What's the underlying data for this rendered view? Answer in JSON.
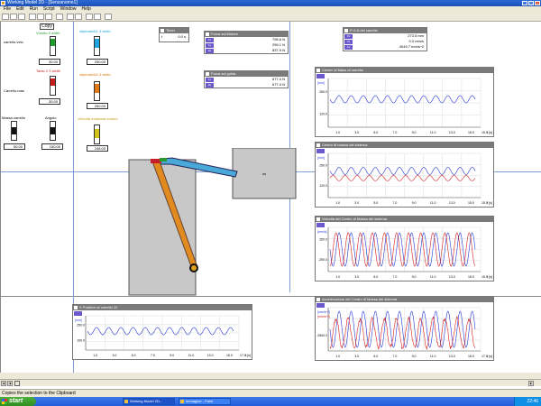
{
  "app": {
    "title": "Working Model 2D - [Senzanome1]",
    "window_buttons": [
      "_",
      "□",
      "×"
    ]
  },
  "menu": [
    "File",
    "Edit",
    "Run",
    "Script",
    "Window",
    "Help"
  ],
  "run_controls": {
    "run": "Run",
    "stop": "Stop",
    "reset": "Reset"
  },
  "copy_button": "Copy",
  "controls": [
    {
      "label": "carrello-velo",
      "value": "30.00",
      "color": "#1f9e2d"
    },
    {
      "label": "Carrello-mas",
      "value": "30.00",
      "color": "#c81e1e"
    },
    {
      "label": "Massa carrello",
      "value": "50.00",
      "color": "#111111"
    },
    {
      "label": "Angolo",
      "value": "150.00",
      "color": "#111111"
    },
    {
      "label": "stiperaddb1 3 width",
      "value": "250.00",
      "color": "#1ea5e0"
    },
    {
      "label": "stiperaddb2 3 width",
      "value": "250.00",
      "color": "#e07a14"
    },
    {
      "label": "Velocità massima motore",
      "value": "248.00",
      "color": "#d0c21a"
    }
  ],
  "control_labels_small": [
    "Vmotto 0 width",
    "Tanto 2 3 width"
  ],
  "meters": {
    "timer": {
      "title": "Timer",
      "label": "t",
      "value": "0.0 s"
    },
    "forza_motore": {
      "title": "Forza sul Motore",
      "rows": [
        {
          "key": "Fx",
          "value": "795.6 N"
        },
        {
          "key": "Fy",
          "value": "259.1 N"
        },
        {
          "key": "|F|",
          "value": "837.9 N"
        }
      ]
    },
    "forza_guida": {
      "title": "Forza sul guida",
      "rows": [
        {
          "key": "Fy",
          "value": "677.4 N"
        },
        {
          "key": "|F|",
          "value": "677.4 N"
        }
      ]
    },
    "pva": {
      "title": "P-V-A del carrello",
      "rows": [
        {
          "key": "Px",
          "value": "273.5 mm"
        },
        {
          "key": "Vx",
          "value": "0.0 mm/s"
        },
        {
          "key": "Ax",
          "value": "4049.7 mm/s^2"
        }
      ]
    }
  },
  "graphs": [
    {
      "title": "Center of Mass of carrello",
      "y_unit": "[mm]",
      "y_ticks": [
        "250.0",
        "120.0"
      ],
      "x_ticks": [
        "1.0",
        "3.0",
        "5.0",
        "7.0",
        "9.0",
        "11.0",
        "13.0",
        "15.0"
      ],
      "x_axis_end": "15.0",
      "x_label": "t [s]"
    },
    {
      "title": "Centro di massa del sistema",
      "y_unit": "[mm]",
      "y_ticks": [
        "250.0",
        "120.0"
      ],
      "x_ticks": [
        "1.0",
        "3.0",
        "5.0",
        "7.0",
        "9.0",
        "11.0",
        "13.0",
        "15.0"
      ],
      "x_axis_end": "15.0",
      "x_label": "t [s]"
    },
    {
      "title": "Velocità del Centro di Massa del sistema",
      "y_unit": "[mm/s]",
      "y_ticks": [
        "250.0",
        "-250.0"
      ],
      "x_ticks": [
        "1.0",
        "3.0",
        "5.0",
        "7.0",
        "9.0",
        "11.0",
        "13.0",
        "15.0"
      ],
      "x_axis_end": "15.0",
      "x_label": "t [s]"
    },
    {
      "title": "X Position of carrello 10",
      "y_unit": "[mm]",
      "y_ticks": [
        "250.0",
        "100.0"
      ],
      "x_ticks": [
        "1.0",
        "3.0",
        "5.0",
        "7.0",
        "9.0",
        "11.0",
        "13.0",
        "15.0"
      ],
      "x_axis_end": "17.0",
      "x_label": "t [s]"
    },
    {
      "title": "Accelerazione del Centro di Massa del sistema",
      "y_unit": "[mm/s^2]",
      "y_unit2": "[mm/s^2]",
      "y_ticks": [
        "-2500.0"
      ],
      "x_ticks": [
        "1.0",
        "3.0",
        "5.0",
        "7.0",
        "9.0",
        "11.0",
        "13.0",
        "15.0"
      ],
      "x_axis_end": "17.0",
      "x_label": "t [s]"
    }
  ],
  "status": "Copies the selection to the Clipboard",
  "taskbar": {
    "start": "start",
    "tasks": [
      "Working Model 2D...",
      "Immagine - Paint"
    ],
    "clock": "22:46"
  },
  "colors": {
    "series_blue": "#2a3ad8",
    "series_red": "#d82020",
    "body_gray": "#c8c8c8",
    "rod_orange": "#e08a20",
    "rod_blue": "#4aa8d8"
  }
}
